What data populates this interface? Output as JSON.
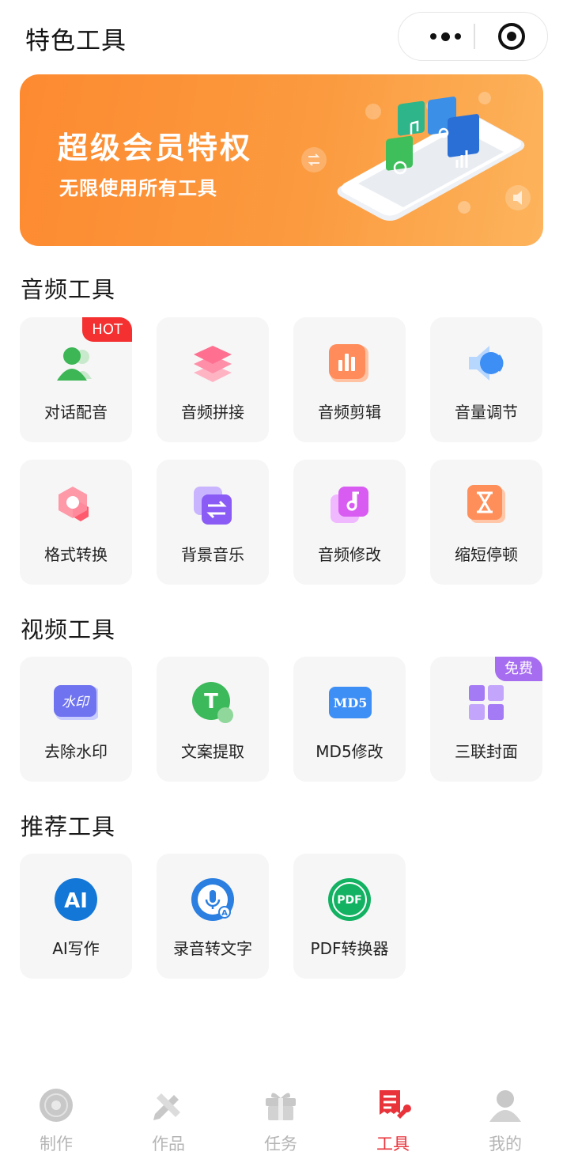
{
  "header": {
    "title": "特色工具"
  },
  "banner": {
    "title": "超级会员特权",
    "subtitle": "无限使用所有工具"
  },
  "sections": {
    "audio": {
      "title": "音频工具",
      "items": [
        {
          "label": "对话配音",
          "badge": "HOT",
          "icon": "users-icon"
        },
        {
          "label": "音频拼接",
          "icon": "layers-icon"
        },
        {
          "label": "音频剪辑",
          "icon": "bar-chart-icon"
        },
        {
          "label": "音量调节",
          "icon": "speaker-icon"
        },
        {
          "label": "格式转换",
          "icon": "hexagon-icon"
        },
        {
          "label": "背景音乐",
          "icon": "swap-icon"
        },
        {
          "label": "音频修改",
          "icon": "music-note-icon"
        },
        {
          "label": "缩短停顿",
          "icon": "hourglass-icon"
        }
      ]
    },
    "video": {
      "title": "视频工具",
      "items": [
        {
          "label": "去除水印",
          "icon": "watermark-icon",
          "icon_text": "水印"
        },
        {
          "label": "文案提取",
          "icon": "text-extract-icon",
          "icon_text": "T"
        },
        {
          "label": "MD5修改",
          "icon": "md5-icon",
          "icon_text": "MD5"
        },
        {
          "label": "三联封面",
          "badge": "免费",
          "icon": "grid-icon"
        }
      ]
    },
    "recommend": {
      "title": "推荐工具",
      "items": [
        {
          "label": "AI写作",
          "icon": "ai-icon",
          "icon_text": "AI"
        },
        {
          "label": "录音转文字",
          "icon": "microphone-icon",
          "icon_text": "A"
        },
        {
          "label": "PDF转换器",
          "icon": "pdf-icon",
          "icon_text": "PDF"
        }
      ]
    }
  },
  "tabbar": {
    "items": [
      {
        "label": "制作",
        "icon": "disc-icon",
        "active": false
      },
      {
        "label": "作品",
        "icon": "pencil-ruler-icon",
        "active": false
      },
      {
        "label": "任务",
        "icon": "gift-icon",
        "active": false
      },
      {
        "label": "工具",
        "icon": "toolbox-icon",
        "active": true
      },
      {
        "label": "我的",
        "icon": "person-icon",
        "active": false
      }
    ]
  },
  "colors": {
    "accent": "#e9333a",
    "banner": "#fd8a30",
    "hot_badge": "#f43030",
    "free_badge": "#a66df0",
    "inactive_tab": "#b5b5b5"
  }
}
